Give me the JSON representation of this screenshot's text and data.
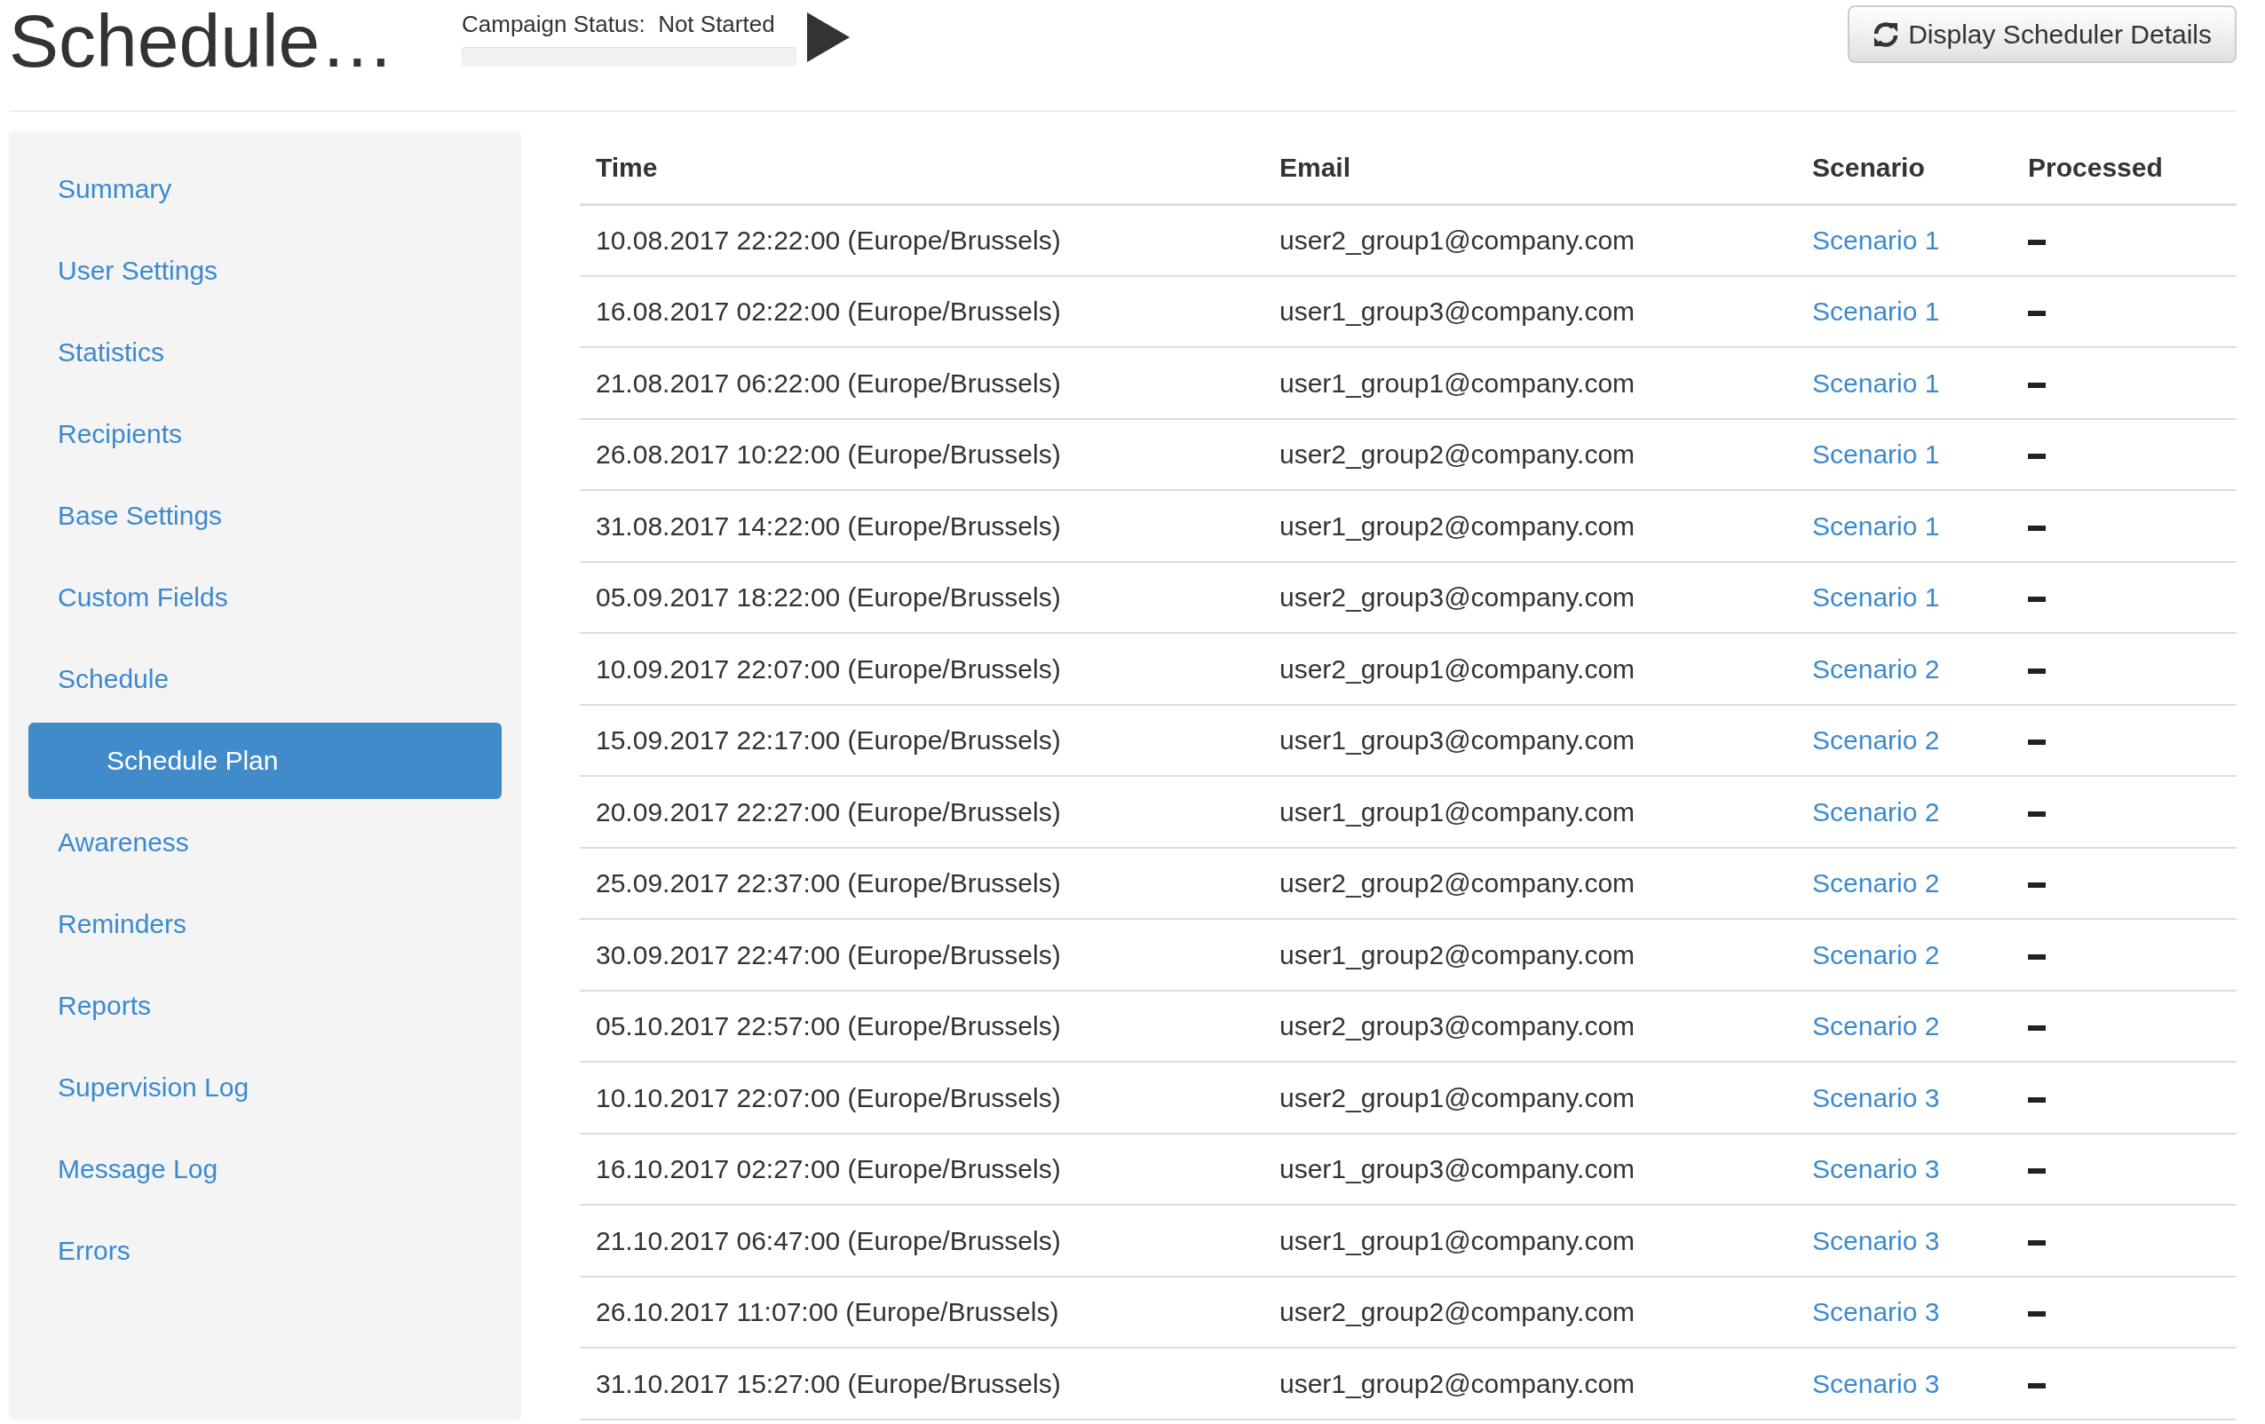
{
  "page_title": "Schedule…",
  "campaign_status": {
    "label": "Campaign Status:",
    "value": "Not Started",
    "level": 0
  },
  "details_button": {
    "label": "Display Scheduler Details"
  },
  "sidebar": {
    "items": [
      {
        "label": "Summary",
        "selected": false
      },
      {
        "label": "User Settings",
        "selected": false
      },
      {
        "label": "Statistics",
        "selected": false
      },
      {
        "label": "Recipients",
        "selected": false
      },
      {
        "label": "Base Settings",
        "selected": false
      },
      {
        "label": "Custom Fields",
        "selected": false
      },
      {
        "label": "Schedule",
        "selected": false,
        "children": [
          {
            "label": "Schedule Plan",
            "selected": true
          }
        ]
      },
      {
        "label": "Awareness",
        "selected": false
      },
      {
        "label": "Reminders",
        "selected": false
      },
      {
        "label": "Reports",
        "selected": false
      },
      {
        "label": "Supervision Log",
        "selected": false
      },
      {
        "label": "Message Log",
        "selected": false
      },
      {
        "label": "Errors",
        "selected": false
      }
    ]
  },
  "table": {
    "columns": [
      "Time",
      "Email",
      "Scenario",
      "Processed"
    ],
    "rows": [
      {
        "time": "10.08.2017 22:22:00 (Europe/Brussels)",
        "email": "user2_group1@company.com",
        "scenario": "Scenario 1",
        "processed": false
      },
      {
        "time": "16.08.2017 02:22:00 (Europe/Brussels)",
        "email": "user1_group3@company.com",
        "scenario": "Scenario 1",
        "processed": false
      },
      {
        "time": "21.08.2017 06:22:00 (Europe/Brussels)",
        "email": "user1_group1@company.com",
        "scenario": "Scenario 1",
        "processed": false
      },
      {
        "time": "26.08.2017 10:22:00 (Europe/Brussels)",
        "email": "user2_group2@company.com",
        "scenario": "Scenario 1",
        "processed": false
      },
      {
        "time": "31.08.2017 14:22:00 (Europe/Brussels)",
        "email": "user1_group2@company.com",
        "scenario": "Scenario 1",
        "processed": false
      },
      {
        "time": "05.09.2017 18:22:00 (Europe/Brussels)",
        "email": "user2_group3@company.com",
        "scenario": "Scenario 1",
        "processed": false
      },
      {
        "time": "10.09.2017 22:07:00 (Europe/Brussels)",
        "email": "user2_group1@company.com",
        "scenario": "Scenario 2",
        "processed": false
      },
      {
        "time": "15.09.2017 22:17:00 (Europe/Brussels)",
        "email": "user1_group3@company.com",
        "scenario": "Scenario 2",
        "processed": false
      },
      {
        "time": "20.09.2017 22:27:00 (Europe/Brussels)",
        "email": "user1_group1@company.com",
        "scenario": "Scenario 2",
        "processed": false
      },
      {
        "time": "25.09.2017 22:37:00 (Europe/Brussels)",
        "email": "user2_group2@company.com",
        "scenario": "Scenario 2",
        "processed": false
      },
      {
        "time": "30.09.2017 22:47:00 (Europe/Brussels)",
        "email": "user1_group2@company.com",
        "scenario": "Scenario 2",
        "processed": false
      },
      {
        "time": "05.10.2017 22:57:00 (Europe/Brussels)",
        "email": "user2_group3@company.com",
        "scenario": "Scenario 2",
        "processed": false
      },
      {
        "time": "10.10.2017 22:07:00 (Europe/Brussels)",
        "email": "user2_group1@company.com",
        "scenario": "Scenario 3",
        "processed": false
      },
      {
        "time": "16.10.2017 02:27:00 (Europe/Brussels)",
        "email": "user1_group3@company.com",
        "scenario": "Scenario 3",
        "processed": false
      },
      {
        "time": "21.10.2017 06:47:00 (Europe/Brussels)",
        "email": "user1_group1@company.com",
        "scenario": "Scenario 3",
        "processed": false
      },
      {
        "time": "26.10.2017 11:07:00 (Europe/Brussels)",
        "email": "user2_group2@company.com",
        "scenario": "Scenario 3",
        "processed": false
      },
      {
        "time": "31.10.2017 15:27:00 (Europe/Brussels)",
        "email": "user1_group2@company.com",
        "scenario": "Scenario 3",
        "processed": false
      }
    ]
  }
}
